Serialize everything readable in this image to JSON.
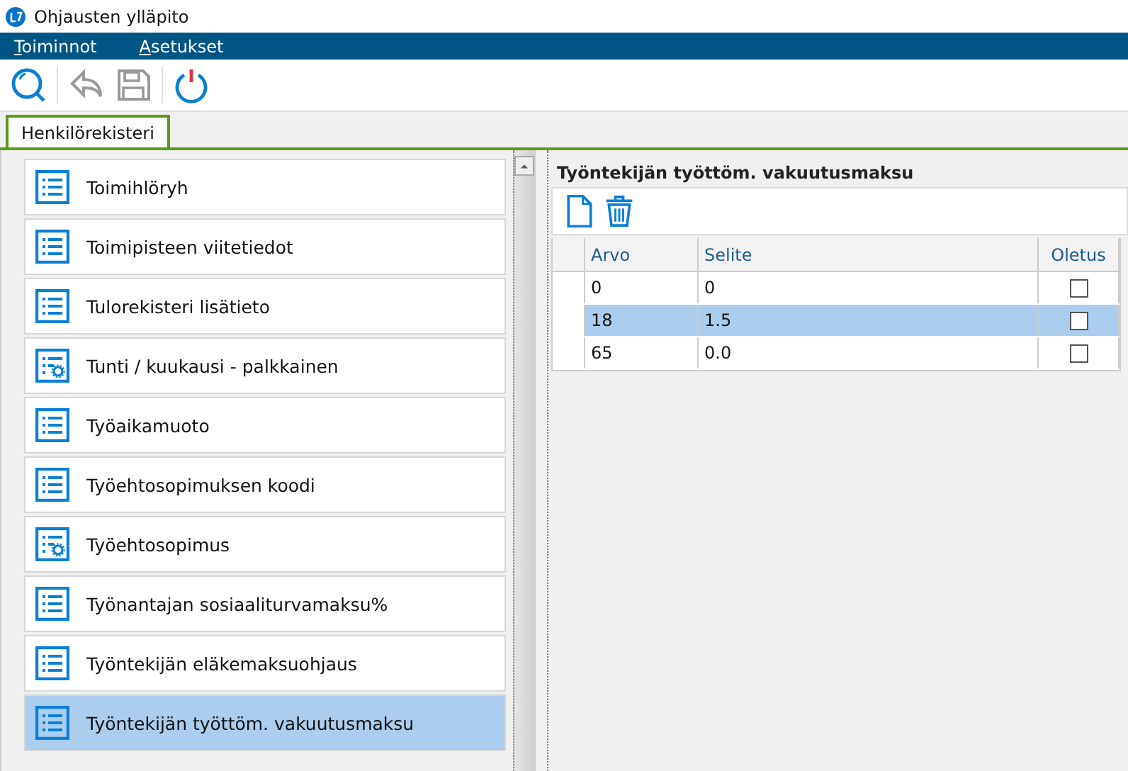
{
  "window": {
    "title": "Ohjausten ylläpito"
  },
  "menu": [
    "Toiminnot",
    "Asetukset"
  ],
  "tabs": [
    {
      "label": "Henkilörekisteri",
      "selected": true
    }
  ],
  "list": [
    {
      "label": "Toimihlöryh",
      "kind": "list",
      "selected": false
    },
    {
      "label": "Toimipisteen viitetiedot",
      "kind": "list",
      "selected": false
    },
    {
      "label": "Tulorekisteri lisätieto",
      "kind": "list",
      "selected": false
    },
    {
      "label": "Tunti / kuukausi - palkkainen",
      "kind": "settings",
      "selected": false
    },
    {
      "label": "Työaikamuoto",
      "kind": "list",
      "selected": false
    },
    {
      "label": "Työehtosopimuksen koodi",
      "kind": "list",
      "selected": false
    },
    {
      "label": "Työehtosopimus",
      "kind": "settings",
      "selected": false
    },
    {
      "label": "Työnantajan sosiaaliturvamaksu%",
      "kind": "list",
      "selected": false
    },
    {
      "label": "Työntekijän eläkemaksuohjaus",
      "kind": "list",
      "selected": false
    },
    {
      "label": "Työntekijän työttöm. vakuutusmaksu",
      "kind": "list",
      "selected": true
    }
  ],
  "detail": {
    "title": "Työntekijän työttöm. vakuutusmaksu",
    "table": {
      "columns": [
        "Arvo",
        "Selite",
        "Oletus"
      ],
      "rows": [
        {
          "arvo": "0",
          "selite": "0",
          "oletus": false,
          "selected": false
        },
        {
          "arvo": "18",
          "selite": "1.5",
          "oletus": false,
          "selected": true
        },
        {
          "arvo": "65",
          "selite": "0.0",
          "oletus": false,
          "selected": false
        }
      ]
    }
  }
}
